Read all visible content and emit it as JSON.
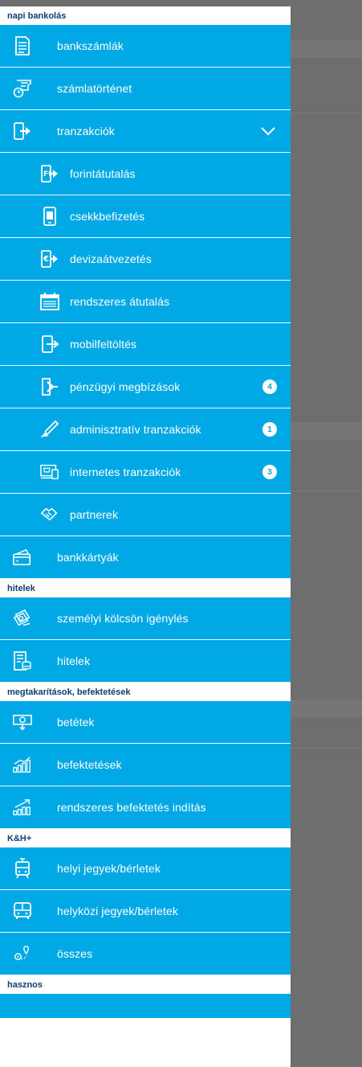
{
  "colors": {
    "accent": "#00a9e6",
    "section_text": "#0d3f74",
    "backdrop": "#6e6e6e",
    "badge_bg": "#ffffff"
  },
  "sections": [
    {
      "title": "napi bankolás",
      "items": [
        {
          "label": "bankszámlák",
          "icon": "document-icon"
        },
        {
          "label": "számlatörténet",
          "icon": "history-receipt-icon"
        },
        {
          "label": "tranzakciók",
          "icon": "transfer-icon",
          "expanded": true
        },
        {
          "label": "forintátutalás",
          "icon": "forint-transfer-icon",
          "sub": true
        },
        {
          "label": "csekkbefizetés",
          "icon": "cheque-phone-icon",
          "sub": true
        },
        {
          "label": "devizaátvezetés",
          "icon": "euro-transfer-icon",
          "sub": true
        },
        {
          "label": "rendszeres átutalás",
          "icon": "calendar-icon",
          "sub": true
        },
        {
          "label": "mobilfeltöltés",
          "icon": "mobile-topup-icon",
          "sub": true
        },
        {
          "label": "pénzügyi megbízások",
          "icon": "financial-order-icon",
          "sub": true,
          "badge": "4"
        },
        {
          "label": "adminisztratív tranzakciók",
          "icon": "pen-sign-icon",
          "sub": true,
          "badge": "1"
        },
        {
          "label": "internetes tranzakciók",
          "icon": "internet-cart-icon",
          "sub": true,
          "badge": "3"
        },
        {
          "label": "partnerek",
          "icon": "handshake-icon",
          "sub": true
        },
        {
          "label": "bankkártyák",
          "icon": "wallet-card-icon"
        }
      ]
    },
    {
      "title": "hitelek",
      "items": [
        {
          "label": "személyi kölcsön igénylés",
          "icon": "money-icon"
        },
        {
          "label": "hitelek",
          "icon": "loan-document-icon"
        }
      ]
    },
    {
      "title": "megtakarítások, befektetések",
      "items": [
        {
          "label": "betétek",
          "icon": "deposit-icon"
        },
        {
          "label": "befektetések",
          "icon": "investment-chart-icon"
        },
        {
          "label": "rendszeres befektetés indítás",
          "icon": "growth-chart-icon"
        }
      ]
    },
    {
      "title": "K&H+",
      "items": [
        {
          "label": "helyi jegyek/bérletek",
          "icon": "tram-icon"
        },
        {
          "label": "helyközi jegyek/bérletek",
          "icon": "bus-icon"
        },
        {
          "label": "összes",
          "icon": "location-pins-icon"
        }
      ]
    },
    {
      "title": "hasznos",
      "items": []
    }
  ]
}
